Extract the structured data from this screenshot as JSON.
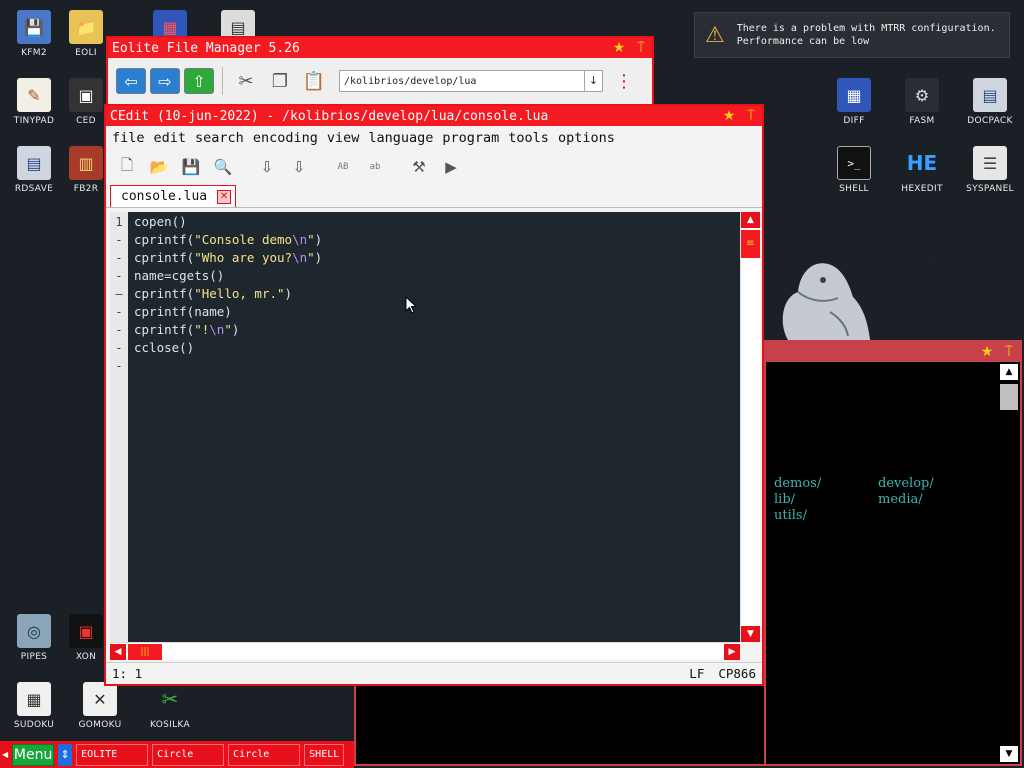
{
  "desktop_icons": [
    {
      "label": "KFM2",
      "glyph": "💾"
    },
    {
      "label": "EOLI",
      "glyph": "📁"
    },
    {
      "label": "",
      "glyph": "▦"
    },
    {
      "label": "",
      "glyph": "▤"
    },
    {
      "label": "TINYPAD",
      "glyph": "✎"
    },
    {
      "label": "CED",
      "glyph": "▣"
    },
    {
      "label": "RDSAVE",
      "glyph": "▤"
    },
    {
      "label": "FB2R",
      "glyph": "▥"
    },
    {
      "label": "DIFF",
      "glyph": "▦"
    },
    {
      "label": "FASM",
      "glyph": "⚙"
    },
    {
      "label": "DOCPACK",
      "glyph": "▤"
    },
    {
      "label": "SHELL",
      "glyph": ">_"
    },
    {
      "label": "HEXEDIT",
      "glyph": "HE"
    },
    {
      "label": "SYSPANEL",
      "glyph": "☰"
    },
    {
      "label": "PIPES",
      "glyph": "◎"
    },
    {
      "label": "XON",
      "glyph": "▣"
    },
    {
      "label": "SUDOKU",
      "glyph": "▦"
    },
    {
      "label": "GOMOKU",
      "glyph": "✕"
    },
    {
      "label": "KOSILKA",
      "glyph": "✂"
    }
  ],
  "eolite": {
    "title": "Eolite File Manager 5.26",
    "path": "/kolibrios/develop/lua"
  },
  "cedit": {
    "title": "CEdit (10-jun-2022) - /kolibrios/develop/lua/console.lua",
    "menu": [
      "file",
      "edit",
      "search",
      "encoding",
      "view",
      "language",
      "program",
      "tools",
      "options"
    ],
    "tab": "console.lua",
    "gutter": [
      "1",
      "-",
      "-",
      "-",
      "—",
      "-",
      "-",
      "-",
      "-"
    ],
    "status": {
      "position": "1: 1",
      "eol": "LF",
      "encoding": "CP866"
    }
  },
  "code_lines": [
    [
      {
        "t": "copen()",
        "c": "plain"
      }
    ],
    [
      {
        "t": "cprintf(",
        "c": "plain"
      },
      {
        "t": "\"Console demo",
        "c": "str"
      },
      {
        "t": "\\n",
        "c": "esc"
      },
      {
        "t": "\"",
        "c": "str"
      },
      {
        "t": ")",
        "c": "plain"
      }
    ],
    [
      {
        "t": "cprintf(",
        "c": "plain"
      },
      {
        "t": "\"Who are you?",
        "c": "str"
      },
      {
        "t": "\\n",
        "c": "esc"
      },
      {
        "t": "\"",
        "c": "str"
      },
      {
        "t": ")",
        "c": "plain"
      }
    ],
    [
      {
        "t": "name=cgets()",
        "c": "plain"
      }
    ],
    [
      {
        "t": "cprintf(",
        "c": "plain"
      },
      {
        "t": "\"Hello, mr.\"",
        "c": "str"
      },
      {
        "t": ")",
        "c": "plain"
      }
    ],
    [
      {
        "t": "cprintf(name)",
        "c": "plain"
      }
    ],
    [
      {
        "t": "cprintf(",
        "c": "plain"
      },
      {
        "t": "\"!",
        "c": "str"
      },
      {
        "t": "\\n",
        "c": "esc"
      },
      {
        "t": "\"",
        "c": "str"
      },
      {
        "t": ")",
        "c": "plain"
      }
    ],
    [
      {
        "t": "cclose()",
        "c": "plain"
      }
    ],
    [
      {
        "t": "",
        "c": "plain"
      }
    ]
  ],
  "shell": {
    "dirs": [
      [
        "demos/",
        "develop/"
      ],
      [
        "lib/",
        "media/"
      ],
      [
        "utils/",
        ""
      ]
    ]
  },
  "notification": {
    "line1": "There is a problem with MTRR configuration.",
    "line2": "Performance can be low"
  },
  "taskbar": {
    "menu_label": "Menu",
    "items": [
      "EOLITE",
      "Circle",
      "Circle",
      "SHELL"
    ]
  },
  "colors": {
    "accent": "#e8101a",
    "star": "#ffd21a",
    "desktop": "#1b2027",
    "shell_text": "#3fb3b2",
    "menu_green": "#1aa53a"
  }
}
